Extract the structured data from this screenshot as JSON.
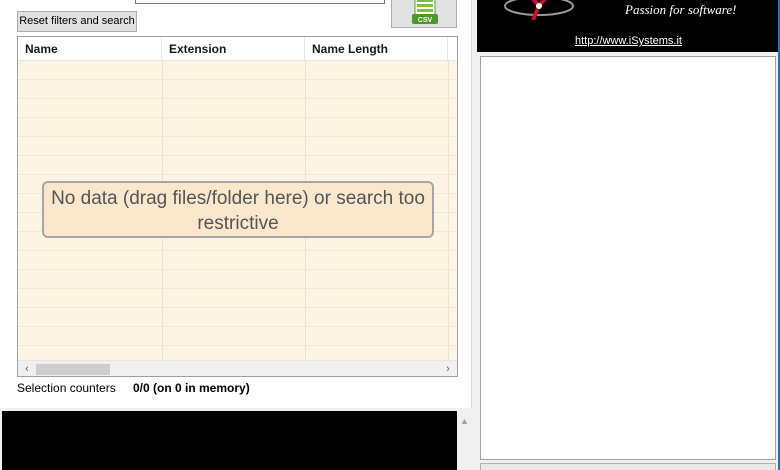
{
  "toolbar": {
    "reset_label": "Reset filters and search",
    "csv_icon_label": "CSV"
  },
  "grid": {
    "columns": [
      "Name",
      "Extension",
      "Name Length",
      ""
    ],
    "empty_message": "No data (drag files/folder here) or search too restrictive",
    "scroll_left": "‹",
    "scroll_right": "›",
    "horizontal_scroll_position": 0
  },
  "status": {
    "selection_label": "Selection counters",
    "selection_value": "0/0 (on 0 in memory)"
  },
  "branding": {
    "tagline": "Passion for software!",
    "link": "http://www.iSystems.it"
  },
  "colors": {
    "grid_background": "#fdf4e3",
    "message_background": "#fbe8cc",
    "panel_black": "#000000",
    "logo_red": "#c8102e"
  },
  "icons": {
    "csv": "csv-file-icon",
    "logo": "isystems-logo"
  }
}
